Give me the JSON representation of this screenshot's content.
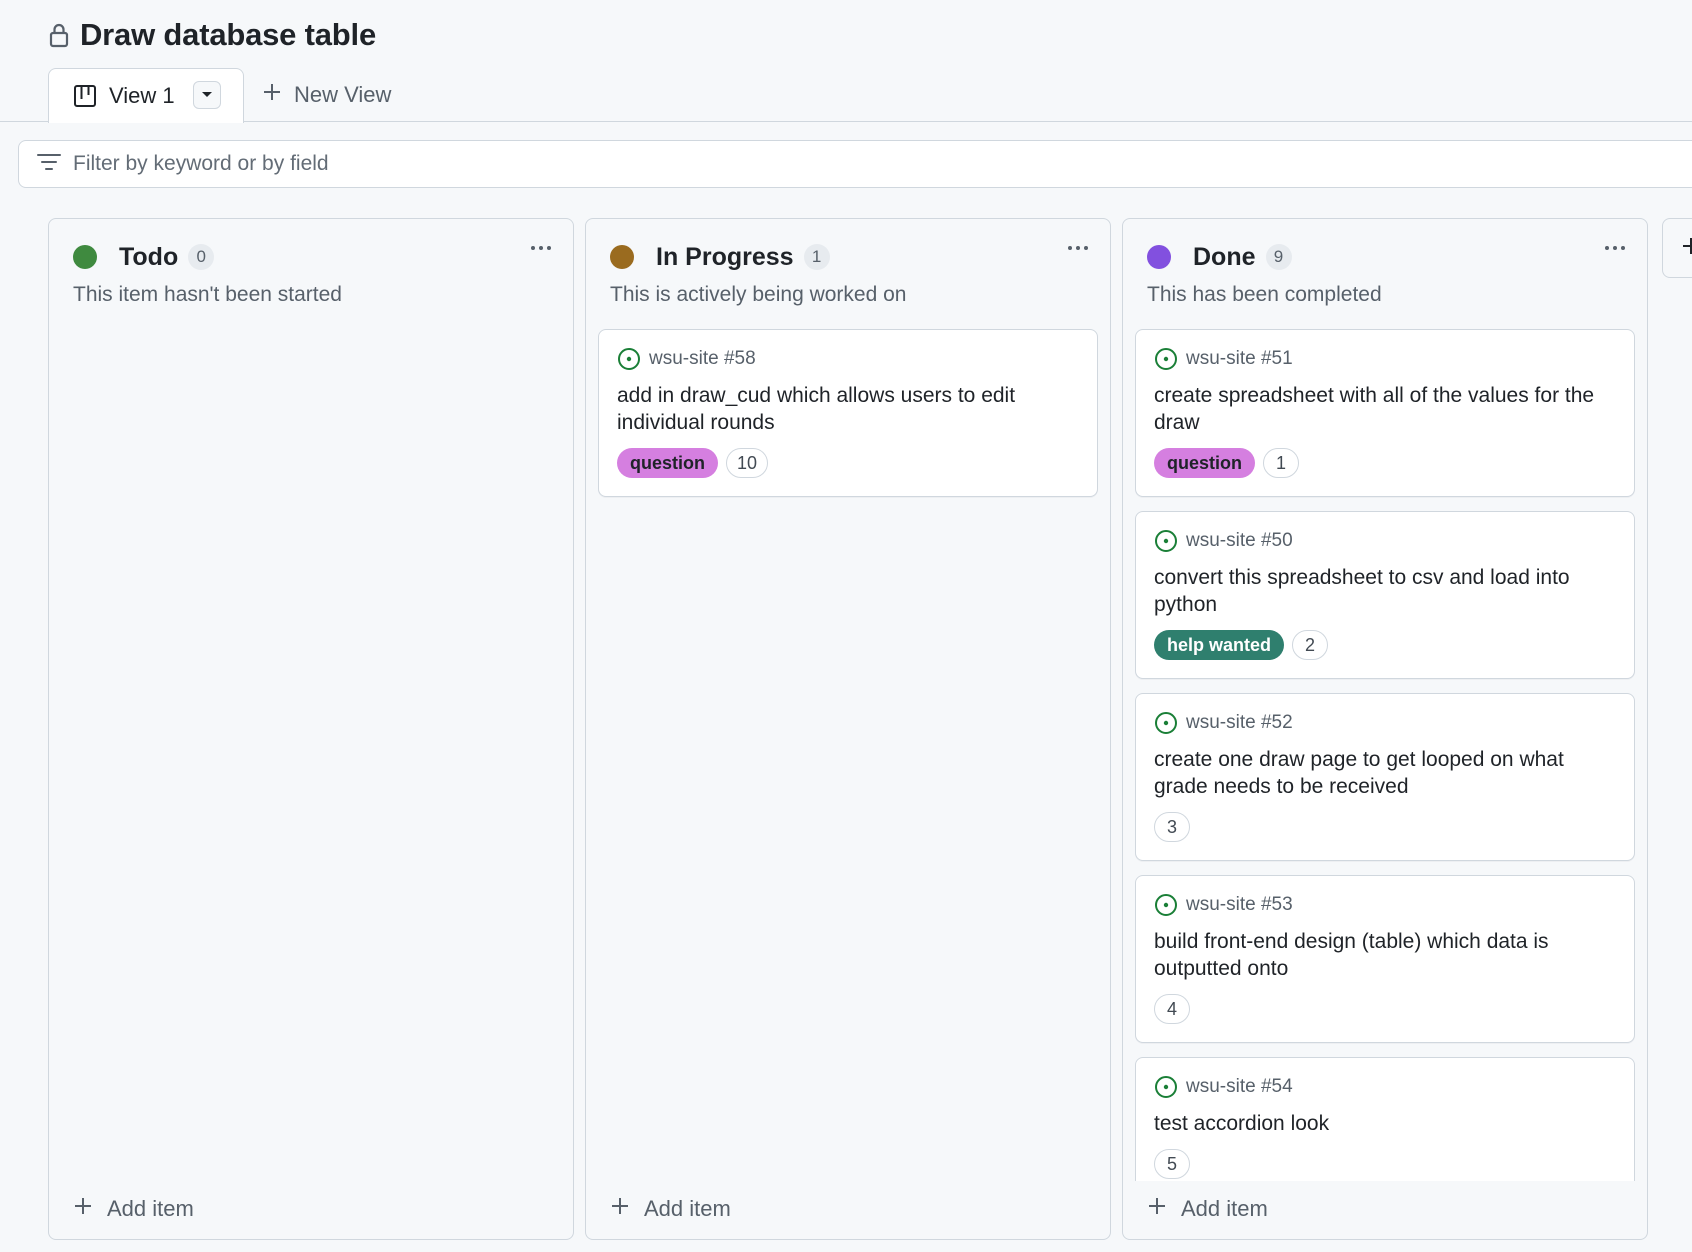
{
  "project": {
    "title": "Draw database table"
  },
  "tabs": {
    "active_label": "View 1",
    "new_view_label": "New View"
  },
  "filter": {
    "placeholder": "Filter by keyword or by field"
  },
  "colors": {
    "todo": "#3f8a3f",
    "in_progress": "#9a6b1f",
    "done": "#8250df",
    "question_label_bg": "#d57fe0",
    "help_wanted_label_bg": "#2f7f6e",
    "open_issue_green": "#1a7f37"
  },
  "columns": [
    {
      "name": "Todo",
      "count": "0",
      "description": "This item hasn't been started",
      "add_label": "Add item",
      "cards": []
    },
    {
      "name": "In Progress",
      "count": "1",
      "description": "This is actively being worked on",
      "add_label": "Add item",
      "cards": [
        {
          "ref": "wsu-site #58",
          "title": "add in draw_cud which allows users to edit individual rounds",
          "label": "question",
          "number": "10"
        }
      ]
    },
    {
      "name": "Done",
      "count": "9",
      "description": "This has been completed",
      "add_label": "Add item",
      "cards": [
        {
          "ref": "wsu-site #51",
          "title": "create spreadsheet with all of the values for the draw",
          "label": "question",
          "number": "1"
        },
        {
          "ref": "wsu-site #50",
          "title": "convert this spreadsheet to csv and load into python",
          "label": "help wanted",
          "number": "2"
        },
        {
          "ref": "wsu-site #52",
          "title": "create one draw page to get looped on what grade needs to be received",
          "number": "3"
        },
        {
          "ref": "wsu-site #53",
          "title": "build front-end design (table) which data is outputted onto",
          "number": "4"
        },
        {
          "ref": "wsu-site #54",
          "title": "test accordion look",
          "number": "5"
        }
      ]
    }
  ]
}
